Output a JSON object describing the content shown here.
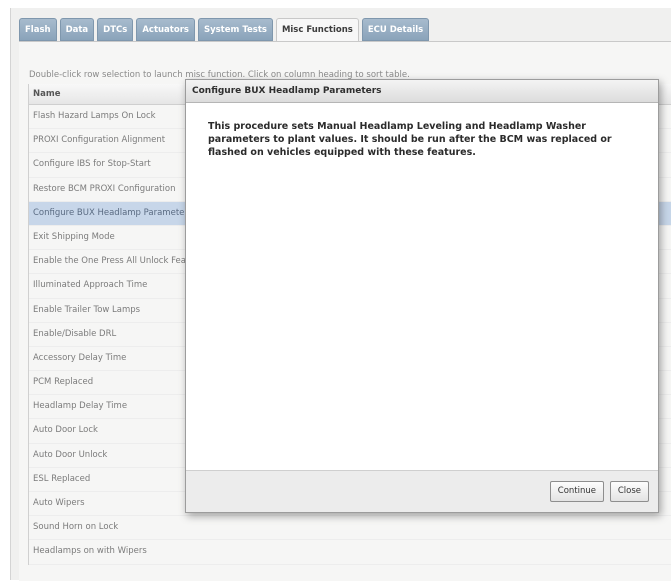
{
  "tabs": [
    {
      "label": "Flash"
    },
    {
      "label": "Data"
    },
    {
      "label": "DTCs"
    },
    {
      "label": "Actuators"
    },
    {
      "label": "System Tests"
    },
    {
      "label": "Misc Functions"
    },
    {
      "label": "ECU Details"
    }
  ],
  "active_tab": "Misc Functions",
  "hint": "Double-click row selection to launch misc function. Click on column heading to sort table.",
  "table": {
    "header": "Name",
    "rows": [
      "Flash Hazard Lamps On Lock",
      "PROXI Configuration Alignment",
      "Configure IBS for Stop-Start",
      "Restore BCM PROXI Configuration",
      "Configure BUX Headlamp Parameters",
      "Exit Shipping Mode",
      "Enable the One Press All Unlock Feature",
      "Illuminated Approach Time",
      "Enable Trailer Tow Lamps",
      "Enable/Disable DRL",
      "Accessory Delay Time",
      "PCM Replaced",
      "Headlamp Delay Time",
      "Auto Door Lock",
      "Auto Door Unlock",
      "ESL Replaced",
      "Auto Wipers",
      "Sound Horn on Lock",
      "Headlamps on with Wipers"
    ],
    "selected_row": "Configure BUX Headlamp Parameters"
  },
  "dialog": {
    "title": "Configure BUX Headlamp Parameters",
    "message": "This procedure sets Manual Headlamp Leveling and Headlamp Washer parameters to plant values. It should be run after the BCM was replaced or flashed on vehicles equipped with these features.",
    "continue_label": "Continue",
    "close_label": "Close"
  }
}
